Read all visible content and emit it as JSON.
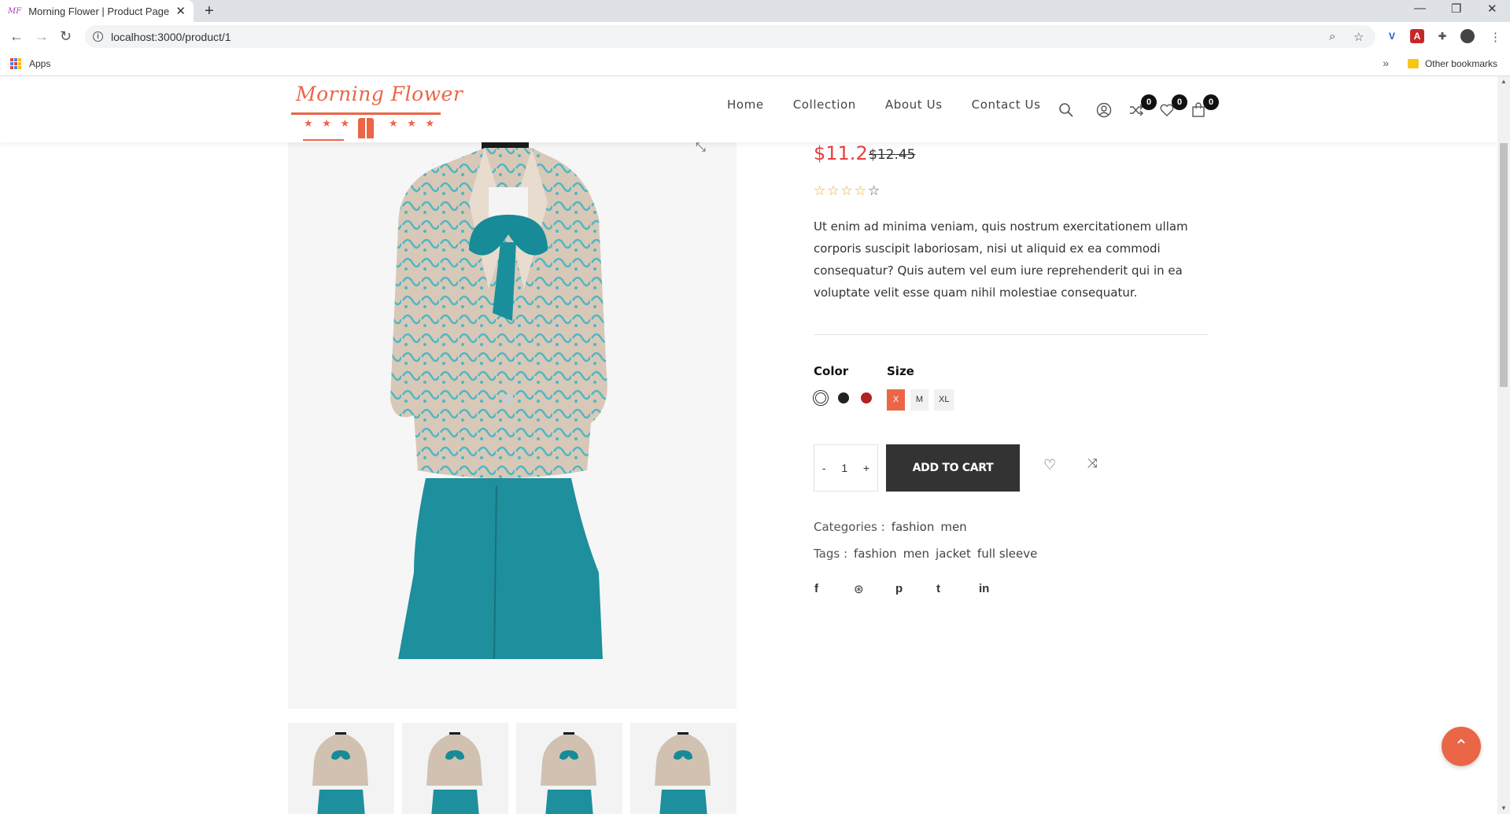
{
  "browser": {
    "tab_title": "Morning Flower | Product Page",
    "favicon_text": "MF",
    "url": "localhost:3000/product/1",
    "bookmarks": {
      "apps_label": "Apps",
      "other_label": "Other bookmarks"
    }
  },
  "header": {
    "logo_text": "Morning Flower",
    "logo_stars": "★ ★ ★",
    "menu": [
      "Home",
      "Collection",
      "About Us",
      "Contact Us"
    ],
    "compare_count": "0",
    "wishlist_count": "0",
    "cart_count": "0"
  },
  "product": {
    "price": "$11.2",
    "old_price": "$12.45",
    "rating": 0,
    "rating_max": 5,
    "description": "Ut enim ad minima veniam, quis nostrum exercitationem ullam corporis suscipit laboriosam, nisi ut aliquid ex ea commodi consequatur? Quis autem vel eum iure reprehenderit qui in ea voluptate velit esse quam nihil molestiae consequatur.",
    "color_label": "Color",
    "size_label": "Size",
    "colors": [
      "#ffffff",
      "#222222",
      "#b22222"
    ],
    "selected_color_index": 0,
    "sizes": [
      "X",
      "M",
      "XL"
    ],
    "selected_size": "X",
    "qty_minus": "-",
    "quantity": "1",
    "qty_plus": "+",
    "add_to_cart": "ADD TO CART",
    "categories_label": "Categories :",
    "categories": [
      "fashion",
      "men"
    ],
    "tags_label": "Tags :",
    "tags": [
      "fashion",
      "men",
      "jacket",
      "full sleeve"
    ]
  },
  "colors": {
    "accent": "#ea6647",
    "price": "#ea3f3f",
    "dark": "#333333"
  }
}
